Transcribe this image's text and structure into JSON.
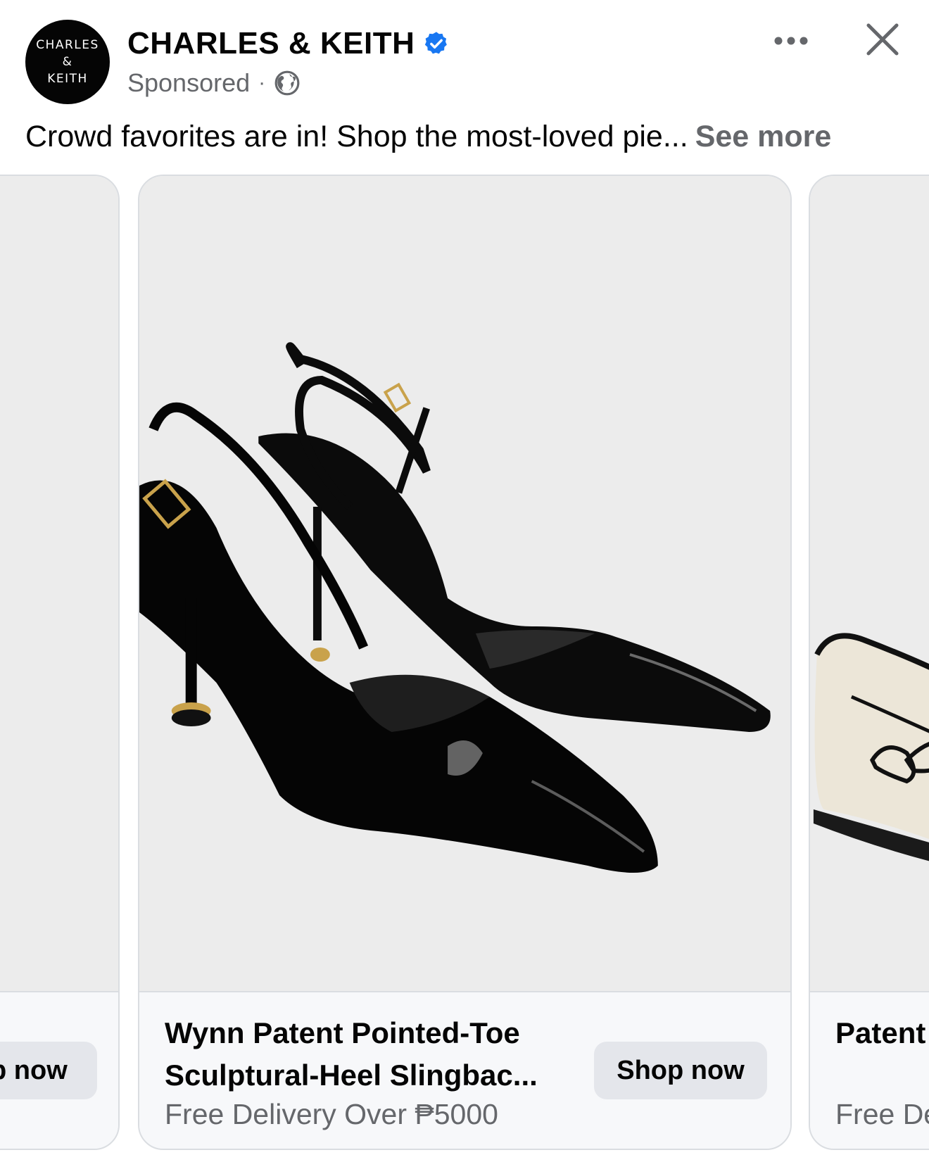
{
  "post": {
    "avatar_line1": "CHARLES",
    "avatar_line2": "&",
    "avatar_line3": "KEITH",
    "brand": "CHARLES & KEITH",
    "sponsored": "Sponsored",
    "separator": "·",
    "caption": "Crowd favorites are in! Shop the most-loved pie...",
    "see_more": "See more",
    "verified_icon": "verified-badge-icon",
    "globe_icon": "globe-icon",
    "accent_color": "#1877f2"
  },
  "carousel": {
    "prev_card": {
      "shop_label": "Shop now"
    },
    "main_card": {
      "title": "Wynn Patent Pointed-Toe Sculptural-Heel Slingbac...",
      "subtitle": "Free Delivery Over ₱5000",
      "shop_label": "Shop now"
    },
    "next_card": {
      "title": "Patent Pointed",
      "subtitle": "Free Delivery"
    }
  }
}
